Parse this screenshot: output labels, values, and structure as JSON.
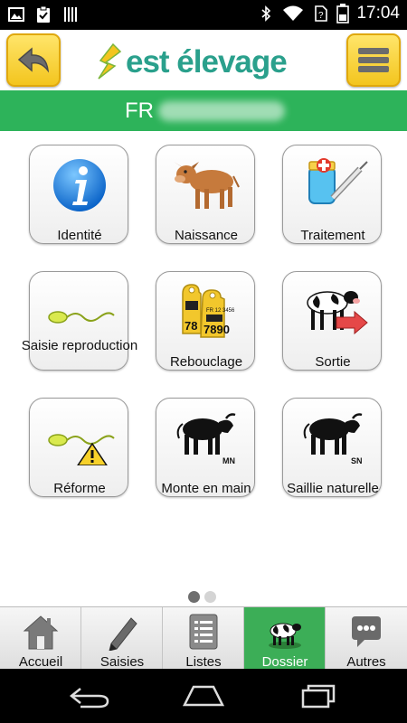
{
  "status_bar": {
    "time": "17:04",
    "icons": [
      "image-icon",
      "clipboard-icon",
      "barcode-icon",
      "bluetooth-icon",
      "wifi-icon",
      "no-sim-icon",
      "battery-icon"
    ]
  },
  "header": {
    "logo_text": "est élevage",
    "back_icon": "back-arrow-icon",
    "menu_icon": "menu-icon",
    "accent": "#f3c51e"
  },
  "id_bar": {
    "prefix": "FR",
    "color": "#2db35a"
  },
  "tiles": [
    {
      "label": "Identité",
      "icon": "info-icon"
    },
    {
      "label": "Naissance",
      "icon": "calf-icon"
    },
    {
      "label": "Traitement",
      "icon": "medicine-icon"
    },
    {
      "label": "Saisie reproduction",
      "icon": "sperm-icon"
    },
    {
      "label": "Rebouclage",
      "icon": "ear-tags-icon",
      "tag_text_1": "78",
      "tag_text_2": "7890",
      "tag_small": "FR 12 3456"
    },
    {
      "label": "Sortie",
      "icon": "cow-exit-icon"
    },
    {
      "label": "Réforme",
      "icon": "sperm-warning-icon"
    },
    {
      "label": "Monte en main",
      "icon": "bull-icon",
      "badge": "MN"
    },
    {
      "label": "Saillie naturelle",
      "icon": "bull-icon",
      "badge": "SN"
    }
  ],
  "pagination": {
    "current": 1,
    "total": 2
  },
  "tabs": [
    {
      "label": "Accueil",
      "icon": "home-icon",
      "active": false
    },
    {
      "label": "Saisies",
      "icon": "pencil-icon",
      "active": false
    },
    {
      "label": "Listes",
      "icon": "list-icon",
      "active": false
    },
    {
      "label": "Dossier",
      "icon": "cow-icon",
      "active": true
    },
    {
      "label": "Autres",
      "icon": "chat-icon",
      "active": false
    }
  ],
  "nav_bar": {
    "icons": [
      "back-icon",
      "home-icon",
      "recents-icon"
    ]
  }
}
